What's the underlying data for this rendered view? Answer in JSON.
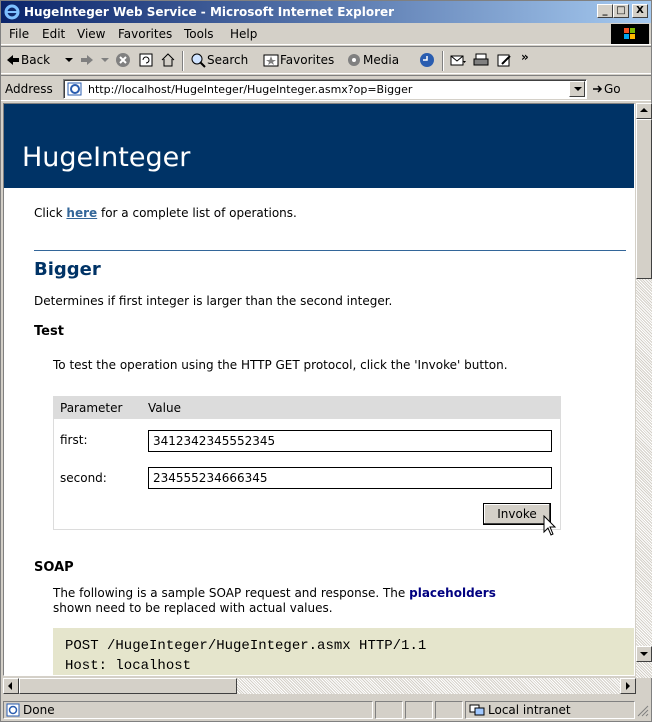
{
  "window": {
    "title": "HugeInteger Web Service - Microsoft Internet Explorer",
    "min_label": "_",
    "max_label": "□",
    "close_label": "X"
  },
  "menu": [
    "File",
    "Edit",
    "View",
    "Favorites",
    "Tools",
    "Help"
  ],
  "toolbar": {
    "back": "Back",
    "search": "Search",
    "favorites": "Favorites",
    "media": "Media",
    "more": "»"
  },
  "address": {
    "label": "Address",
    "url": "http://localhost/HugeInteger/HugeInteger.asmx?op=Bigger",
    "go": "Go"
  },
  "page": {
    "banner_title": "HugeInteger",
    "intro_before": "Click ",
    "intro_link": "here",
    "intro_after": " for a complete list of operations.",
    "operation_name": "Bigger",
    "operation_desc": "Determines if first integer is larger than the second integer.",
    "test_heading": "Test",
    "test_desc": "To test the operation using the HTTP GET protocol, click the 'Invoke' button.",
    "param_header": "Parameter",
    "value_header": "Value",
    "params": [
      {
        "name": "first:",
        "value": "3412342345552345"
      },
      {
        "name": "second:",
        "value": "234555234666345"
      }
    ],
    "invoke_label": "Invoke",
    "soap_heading": "SOAP",
    "soap_desc_before": "The following is a sample SOAP request and response. The ",
    "soap_desc_link": "placeholders",
    "soap_desc_line2": "shown need to be replaced with actual values.",
    "code_line1": "POST /HugeInteger/HugeInteger.asmx HTTP/1.1",
    "code_line2": "Host: localhost"
  },
  "status": {
    "text": "Done",
    "zone": "Local intranet"
  },
  "colors": {
    "banner": "#003366",
    "link": "#336699",
    "code_bg": "#e5e5cc"
  }
}
